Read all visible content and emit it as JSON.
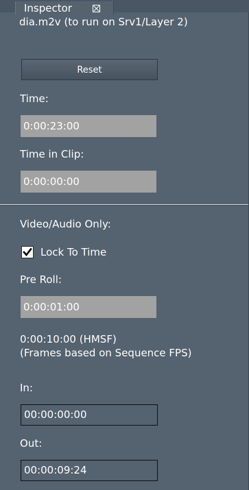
{
  "tab": {
    "label": "Inspector",
    "close_icon": "close-box-icon"
  },
  "clip_title": "dia.m2v (to run on Srv1/Layer 2)",
  "reset_label": "Reset",
  "time": {
    "label": "Time:",
    "value": "0:00:23:00"
  },
  "time_in_clip": {
    "label": "Time in Clip:",
    "value": "0:00:00:00"
  },
  "video_audio_only_label": "Video/Audio Only:",
  "lock_to_time": {
    "label": "Lock To Time",
    "checked": true,
    "icon": "checkmark-icon"
  },
  "pre_roll": {
    "label": "Pre Roll:",
    "value": "0:00:01:00"
  },
  "duration_text": "0:00:10:00 (HMSF)",
  "fps_note": "(Frames based on Sequence FPS)",
  "in_point": {
    "label": "In:",
    "value": "00:00:00:00"
  },
  "out_point": {
    "label": "Out:",
    "value": "00:00:09:24"
  },
  "colors": {
    "panel_bg": "#55626f",
    "readonly_field_bg": "#a2a2a2",
    "text": "#ffffff"
  }
}
